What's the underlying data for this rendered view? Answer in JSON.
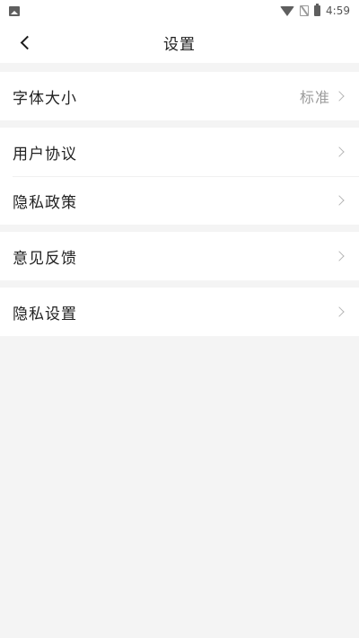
{
  "status_bar": {
    "time": "4:59"
  },
  "header": {
    "title": "设置",
    "back_icon": "chevron-left-icon"
  },
  "groups": [
    {
      "items": [
        {
          "label": "字体大小",
          "value": "标准"
        }
      ]
    },
    {
      "items": [
        {
          "label": "用户协议"
        },
        {
          "label": "隐私政策"
        }
      ]
    },
    {
      "items": [
        {
          "label": "意见反馈"
        }
      ]
    },
    {
      "items": [
        {
          "label": "隐私设置"
        }
      ]
    }
  ],
  "colors": {
    "background": "#f4f4f4",
    "surface": "#ffffff",
    "text": "#222222",
    "secondary_text": "#9b9b9b",
    "chevron": "#b5b5b5"
  }
}
